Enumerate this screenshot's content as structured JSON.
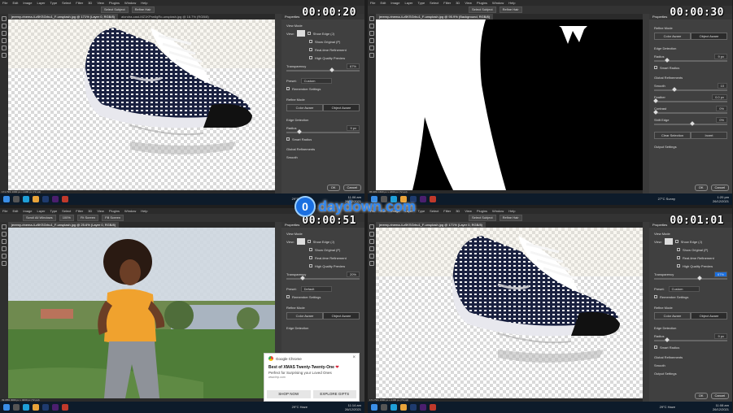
{
  "menu": [
    "File",
    "Edit",
    "Image",
    "Layer",
    "Type",
    "Select",
    "Filter",
    "3D",
    "View",
    "Plugins",
    "Window",
    "Help"
  ],
  "options": {
    "select_subject": "Select Subject",
    "refine_hair": "Refine Hair"
  },
  "quads": [
    {
      "timestamp": "00:00:20",
      "doc_tab": "jeremy-rinema-ii-z5KSGrhu1_F-unsplash.jpg @ 171% (Layer 0, RGB/8)",
      "doc_tab2": "alondra-cast-MZ1KPrw6gRo-unsplash.jpg @ 16.7% (RGB/8)",
      "status": "171.79%   1600 px x 2400 px (72 ppi)",
      "panel": {
        "title": "Properties",
        "view_mode": "View Mode",
        "view": "View:",
        "show_edge": "Show Edge (J)",
        "show_original": "Show Original (P)",
        "realtime": "Real-time Refinement",
        "hq_preview": "High Quality Preview",
        "transparency": "Transparency",
        "transparency_val": "67%",
        "preset": "Preset:",
        "preset_val": "Custom",
        "remember": "Remember Settings",
        "refine_mode": "Refine Mode",
        "color_aware": "Color Aware",
        "object_aware": "Object Aware",
        "edge_detection": "Edge Detection",
        "radius": "Radius",
        "radius_val": "9 px",
        "smart_radius": "Smart Radius",
        "global": "Global Refinements",
        "smooth": "Smooth"
      },
      "taskbar": {
        "weather": "29°C  Haze",
        "time": "11:06 am",
        "date": "26/12/2021"
      }
    },
    {
      "timestamp": "00:00:30",
      "doc_tab": "jeremy-rinema-ii-z5KSGrhu1_F-unsplash.jpg @ 95.9% (Background, RGB/8)",
      "status": "95.99%   1600 px x 2400 px (72 ppi)",
      "panel": {
        "title": "Properties",
        "refine_mode": "Refine Mode",
        "color_aware": "Color Aware",
        "object_aware": "Object Aware",
        "edge_detection": "Edge Detection",
        "radius": "Radius",
        "radius_val": "9 px",
        "smart_radius": "Smart Radius",
        "global": "Global Refinements",
        "smooth": "Smooth",
        "smooth_val": "10",
        "feather": "Feather",
        "feather_val": "0.0 px",
        "contrast": "Contrast",
        "contrast_val": "0%",
        "shift_edge": "Shift Edge",
        "shift_val": "0%",
        "clear_selection": "Clear Selection",
        "invert": "Invert",
        "output": "Output Settings"
      },
      "taskbar": {
        "weather": "27°C  Sunny",
        "time": "1:20 pm",
        "date": "26/12/2021"
      }
    },
    {
      "timestamp": "00:00:51",
      "doc_tab": "jeremy-rinema-ii-z5KSGrhu1_F-unsplash.jpg @ 25.6% (Layer 0, RGB/8)",
      "zoom_chips": [
        "Scroll All Windows",
        "100%",
        "Fit Screen",
        "Fill Screen"
      ],
      "status": "39.08%   3000 px x 4000 px (72 ppi)",
      "panel": {
        "title": "Properties",
        "view_mode": "View Mode",
        "view": "View:",
        "show_edge": "Show Edge (J)",
        "show_original": "Show Original (P)",
        "realtime": "Real-time Refinement",
        "hq_preview": "High Quality Preview",
        "transparency": "Transparency",
        "transparency_val": "20%",
        "preset": "Preset:",
        "preset_val": "Default",
        "remember": "Remember Settings",
        "refine_mode": "Refine Mode",
        "color_aware": "Color Aware",
        "object_aware": "Object Aware",
        "edge_detection": "Edge Detection"
      },
      "notification": {
        "source_app": "Google Chrome",
        "title": "Best of XMAS Twenty-Twenty-One",
        "subtitle": "Perfect for Surprising your Loved Ones",
        "site": "www.fnp.com",
        "btn1": "SHOP NOW",
        "btn2": "EXPLORE GIFTS",
        "close": "×"
      },
      "taskbar": {
        "weather": "29°C  Haze",
        "time": "11:14 am",
        "date": "26/12/2021"
      }
    },
    {
      "timestamp": "00:01:01",
      "doc_tab": "jeremy-rinema-ii-z5KSGrhu1_F-unsplash.jpg @ 171% (Layer 0, RGB/8)",
      "status": "171.79%   1600 px x 2400 px (72 ppi)",
      "panel": {
        "title": "Properties",
        "view_mode": "View Mode",
        "view": "View:",
        "show_edge": "Show Edge (J)",
        "show_original": "Show Original (P)",
        "realtime": "Real-time Refinement",
        "hq_preview": "High Quality Preview",
        "transparency": "Transparency",
        "transparency_val": "67%",
        "preset": "Preset:",
        "preset_val": "Custom",
        "remember": "Remember Settings",
        "refine_mode": "Refine Mode",
        "color_aware": "Color Aware",
        "object_aware": "Object Aware",
        "edge_detection": "Edge Detection",
        "radius": "Radius",
        "radius_val": "9 px",
        "smart_radius": "Smart Radius",
        "global": "Global Refinements",
        "smooth": "Smooth",
        "output": "Output Settings"
      },
      "taskbar": {
        "weather": "29°C  Haze",
        "time": "11:08 am",
        "date": "26/12/2021"
      }
    }
  ],
  "dialog": {
    "ok": "OK",
    "cancel": "Cancel"
  },
  "watermark": {
    "logo": "0",
    "text": "daydown.com"
  },
  "colors": {
    "ps_bg": "#3a3a3a",
    "panel": "#404040",
    "taskbar": "#0d1b2a",
    "accent": "#1a6fe0"
  }
}
